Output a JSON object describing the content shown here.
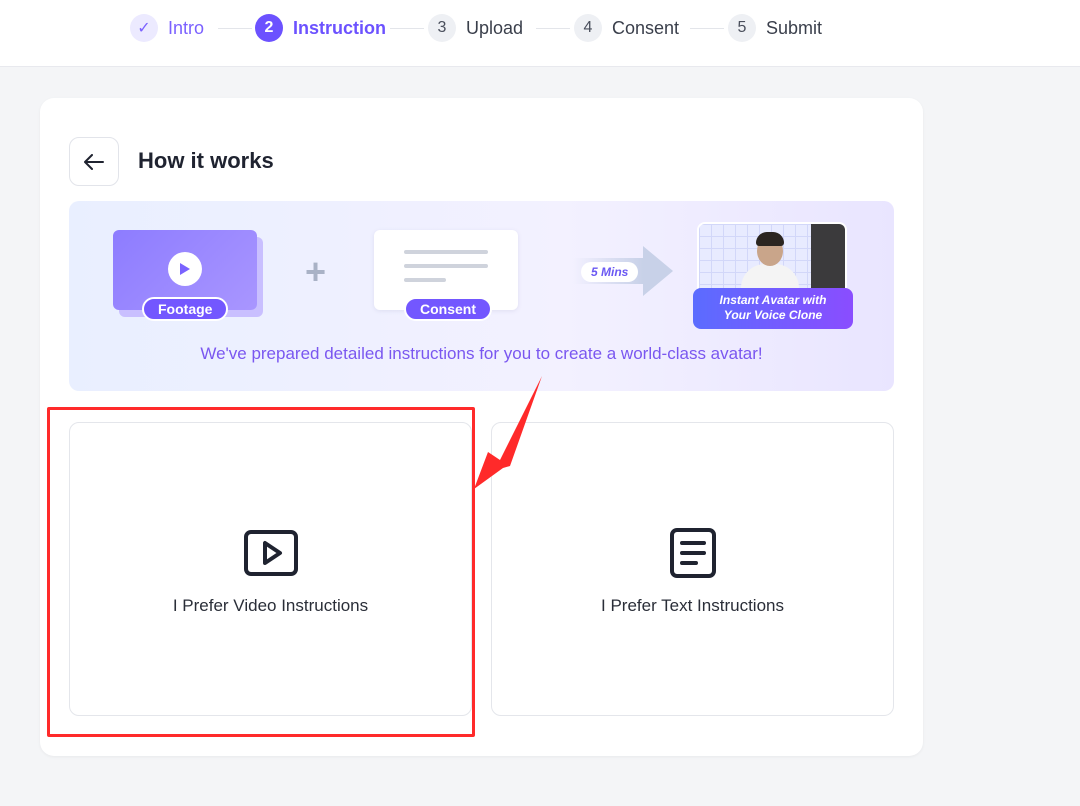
{
  "stepper": {
    "steps": [
      {
        "num": "✓",
        "label": "Intro",
        "state": "done"
      },
      {
        "num": "2",
        "label": "Instruction",
        "state": "active"
      },
      {
        "num": "3",
        "label": "Upload",
        "state": "pending"
      },
      {
        "num": "4",
        "label": "Consent",
        "state": "pending"
      },
      {
        "num": "5",
        "label": "Submit",
        "state": "pending"
      }
    ]
  },
  "card": {
    "title": "How it works",
    "back_icon": "arrow-left-icon"
  },
  "banner": {
    "footage_label": "Footage",
    "consent_label": "Consent",
    "duration_label": "5 Mins",
    "result_line1": "Instant Avatar with",
    "result_line2": "Your Voice Clone",
    "caption": "We've prepared detailed instructions for you to create a world-class avatar!"
  },
  "options": [
    {
      "label": "I Prefer Video Instructions",
      "icon": "video-play-icon"
    },
    {
      "label": "I Prefer Text Instructions",
      "icon": "document-text-icon"
    }
  ],
  "colors": {
    "accent": "#6c52ff",
    "annotation": "#ff2a2a"
  }
}
